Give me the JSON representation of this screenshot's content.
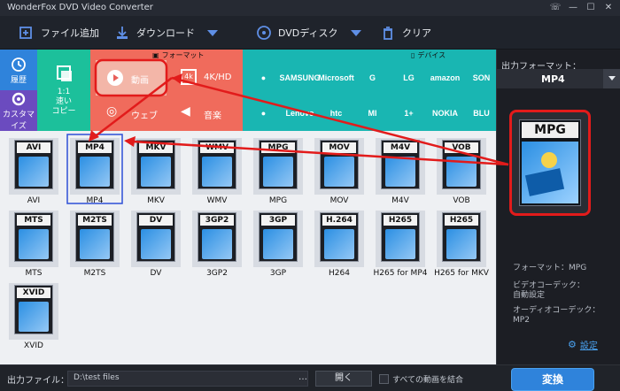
{
  "window": {
    "title": "WonderFox DVD Video Converter",
    "buttons": [
      "☏",
      "—",
      "☐",
      "✕"
    ]
  },
  "toolbar": {
    "add_file": "ファイル追加",
    "download": "ダウンロード",
    "dvd_disc": "DVDディスク",
    "clear": "クリア"
  },
  "left_tiles": {
    "history": "履歴",
    "customize": "カスタマイズ",
    "fast_copy": "1:1\n速い\nコピー"
  },
  "categories": {
    "format_header": "フォーマット",
    "device_header": "デバイス",
    "video": "動画",
    "hd": "4K/HD",
    "web": "ウェブ",
    "music": "音楽"
  },
  "brands": {
    "row1": [
      "",
      "SAMSUNG",
      "Microsoft",
      "G",
      "LG",
      "amazon",
      "SON"
    ],
    "row2": [
      "",
      "Lenovo",
      "htc",
      "MI",
      "1+",
      "NOKIA",
      "BLU"
    ]
  },
  "formats": {
    "row1": [
      {
        "tag": "AVI",
        "name": "AVI"
      },
      {
        "tag": "MP4",
        "name": "MP4"
      },
      {
        "tag": "MKV",
        "name": "MKV"
      },
      {
        "tag": "WMV",
        "name": "WMV"
      },
      {
        "tag": "MPG",
        "name": "MPG"
      },
      {
        "tag": "MOV",
        "name": "MOV"
      },
      {
        "tag": "M4V",
        "name": "M4V"
      },
      {
        "tag": "VOB",
        "name": "VOB"
      }
    ],
    "row2": [
      {
        "tag": "MTS",
        "name": "MTS"
      },
      {
        "tag": "M2TS",
        "name": "M2TS"
      },
      {
        "tag": "DV",
        "name": "DV"
      },
      {
        "tag": "3GP2",
        "name": "3GP2"
      },
      {
        "tag": "3GP",
        "name": "3GP"
      },
      {
        "tag": "H.264",
        "name": "H264"
      },
      {
        "tag": "H265",
        "name": "H265 for MP4"
      },
      {
        "tag": "H265",
        "name": "H265 for MKV"
      }
    ],
    "row3": [
      {
        "tag": "XVID",
        "name": "XVID"
      }
    ]
  },
  "right_panel": {
    "output_format_label": "出力フォーマット：",
    "output_format_value": "MP4",
    "preview_tag": "MPG",
    "info_format": "フォーマット：MPG",
    "info_video_codec_label": "ビデオコーデック：",
    "info_video_codec_value": "自動設定",
    "info_audio_codec_label": "オーディオコーデック：",
    "info_audio_codec_value": "MP2",
    "settings": "設定"
  },
  "bottom": {
    "output_file_label": "出力ファイル：",
    "output_path": "D:\\test files",
    "browse": "…",
    "open": "開く",
    "merge_all": "すべての動画を結合",
    "convert": "変換"
  },
  "colors": {
    "video_tile": "#e85f5a",
    "annotation_red": "#e21b1b",
    "brand_teal": "#19b6b2",
    "convert_blue": "#2f83db"
  }
}
